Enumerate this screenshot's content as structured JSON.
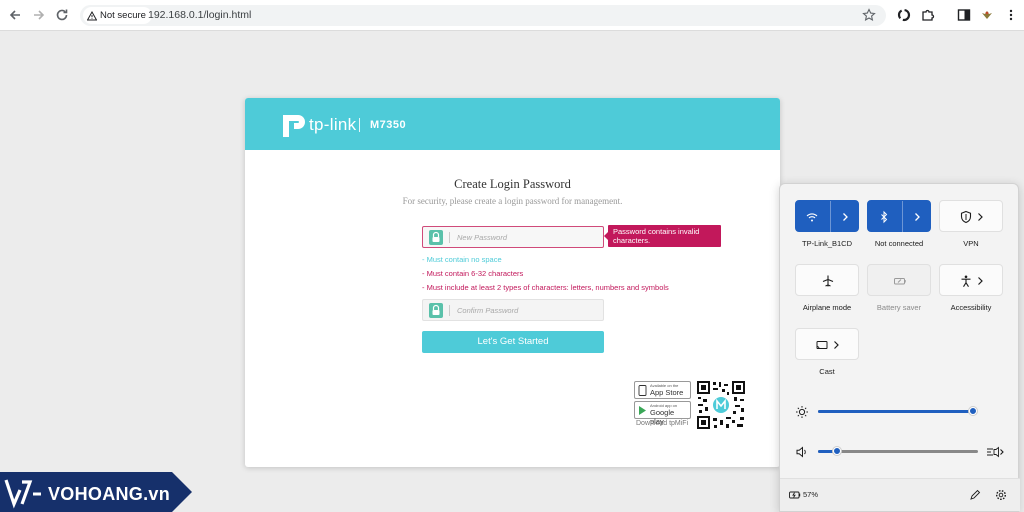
{
  "browser": {
    "security_chip": "Not secure",
    "url": "192.168.0.1/login.html"
  },
  "router": {
    "brand": "tp-link",
    "model": "M7350",
    "title": "Create Login Password",
    "subtitle": "For security, please create a login password for management.",
    "new_password_placeholder": "New Password",
    "confirm_password_placeholder": "Confirm Password",
    "error_tooltip": "Password contains invalid characters.",
    "rules": [
      "- Must contain no space",
      "- Must contain 6-32 characters",
      "- Must include at least 2 types of characters: letters, numbers and symbols"
    ],
    "rule_colors": [
      "#4ecbd8",
      "#c2185b",
      "#c2185b"
    ],
    "start_button": "Let's Get Started",
    "app_store_small": "Available on the",
    "app_store_big": "App Store",
    "google_play_small": "Android app on",
    "google_play_big": "Google play",
    "download_label": "Download tpMiFi",
    "accent_color": "#4ecbd8",
    "error_color": "#c2185b"
  },
  "quick_settings": {
    "tiles": [
      {
        "label": "TP-Link_B1CD",
        "icon": "wifi-icon",
        "state": "on"
      },
      {
        "label": "Not connected",
        "icon": "bluetooth-icon",
        "state": "on"
      },
      {
        "label": "VPN",
        "icon": "shield-icon",
        "state": "off"
      },
      {
        "label": "Airplane mode",
        "icon": "airplane-icon",
        "state": "off"
      },
      {
        "label": "Battery saver",
        "icon": "battery-saver-icon",
        "state": "disabled"
      },
      {
        "label": "Accessibility",
        "icon": "accessibility-icon",
        "state": "off"
      },
      {
        "label": "Cast",
        "icon": "cast-icon",
        "state": "off"
      }
    ],
    "brightness_level": 1.0,
    "volume_level": 0.12,
    "battery": "57%",
    "accent_color": "#1f5fbf"
  },
  "watermark": {
    "text": "VOHOANG.vn"
  }
}
